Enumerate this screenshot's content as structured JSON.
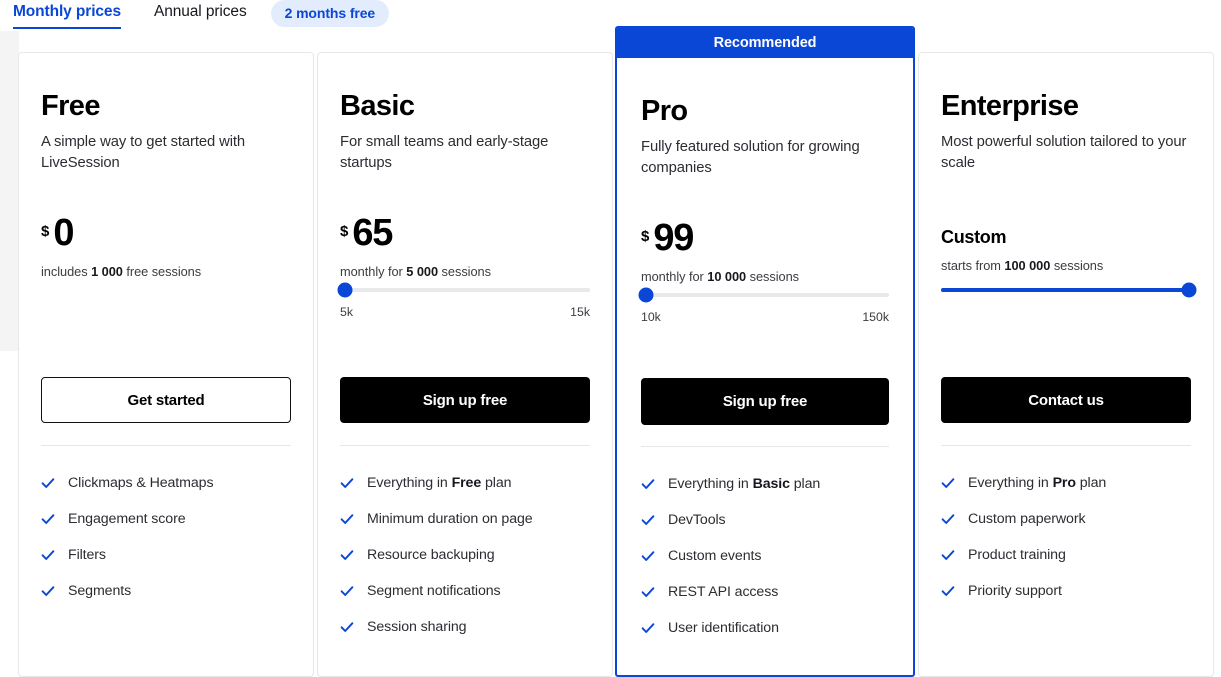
{
  "tabs": {
    "monthly_label": "Monthly prices",
    "annual_label": "Annual prices",
    "promo_badge": "2 months free",
    "accent_color": "#0a47d6",
    "badge_bg": "#e2ecfd"
  },
  "recommended_banner": {
    "label": "Recommended",
    "bg_color": "#0a47d6",
    "text_color": "#ffffff"
  },
  "plans": [
    {
      "id": "free",
      "name": "Free",
      "description": "A simple way to get started with LiveSession",
      "currency": "$",
      "amount": "0",
      "price_note_prefix": "includes ",
      "price_note_bold": "1 000",
      "price_note_suffix": " free sessions",
      "has_slider": false,
      "cta_label": "Get started",
      "cta_style": "outline",
      "features": [
        {
          "prefix": "Clickmaps & Heatmaps",
          "bold": "",
          "suffix": ""
        },
        {
          "prefix": "Engagement score",
          "bold": "",
          "suffix": ""
        },
        {
          "prefix": "Filters",
          "bold": "",
          "suffix": ""
        },
        {
          "prefix": "Segments",
          "bold": "",
          "suffix": ""
        }
      ]
    },
    {
      "id": "basic",
      "name": "Basic",
      "description": "For small teams and early-stage startups",
      "currency": "$",
      "amount": "65",
      "price_note_prefix": "monthly for ",
      "price_note_bold": "5 000",
      "price_note_suffix": " sessions",
      "has_slider": true,
      "slider": {
        "min_label": "5k",
        "max_label": "15k",
        "value_percent": 0,
        "fill_percent": 0,
        "show_scale": true
      },
      "cta_label": "Sign up free",
      "cta_style": "dark",
      "features": [
        {
          "prefix": "Everything in ",
          "bold": "Free",
          "suffix": " plan"
        },
        {
          "prefix": "Minimum duration on page",
          "bold": "",
          "suffix": ""
        },
        {
          "prefix": "Resource backuping",
          "bold": "",
          "suffix": ""
        },
        {
          "prefix": "Segment notifications",
          "bold": "",
          "suffix": ""
        },
        {
          "prefix": "Session sharing",
          "bold": "",
          "suffix": ""
        }
      ]
    },
    {
      "id": "pro",
      "name": "Pro",
      "description": "Fully featured solution for growing companies",
      "currency": "$",
      "amount": "99",
      "price_note_prefix": "monthly for ",
      "price_note_bold": "10 000",
      "price_note_suffix": " sessions",
      "has_slider": true,
      "slider": {
        "min_label": "10k",
        "max_label": "150k",
        "value_percent": 0,
        "fill_percent": 0,
        "show_scale": true
      },
      "cta_label": "Sign up free",
      "cta_style": "dark",
      "recommended": true,
      "features": [
        {
          "prefix": "Everything in ",
          "bold": "Basic",
          "suffix": " plan"
        },
        {
          "prefix": "DevTools",
          "bold": "",
          "suffix": ""
        },
        {
          "prefix": "Custom events",
          "bold": "",
          "suffix": ""
        },
        {
          "prefix": "REST API access",
          "bold": "",
          "suffix": ""
        },
        {
          "prefix": "User identification",
          "bold": "",
          "suffix": ""
        }
      ]
    },
    {
      "id": "enterprise",
      "name": "Enterprise",
      "description": "Most powerful solution tailored to your scale",
      "currency": "",
      "amount": "",
      "custom_label": "Custom",
      "price_note_prefix": "starts from ",
      "price_note_bold": "100 000",
      "price_note_suffix": " sessions",
      "has_slider": true,
      "slider": {
        "min_label": "",
        "max_label": "",
        "value_percent": 100,
        "fill_percent": 100,
        "show_scale": false
      },
      "cta_label": "Contact us",
      "cta_style": "dark",
      "features": [
        {
          "prefix": "Everything in ",
          "bold": "Pro",
          "suffix": " plan"
        },
        {
          "prefix": "Custom paperwork",
          "bold": "",
          "suffix": ""
        },
        {
          "prefix": "Product training",
          "bold": "",
          "suffix": ""
        },
        {
          "prefix": "Priority support",
          "bold": "",
          "suffix": ""
        }
      ]
    }
  ],
  "icons": {
    "check": "check-icon"
  }
}
